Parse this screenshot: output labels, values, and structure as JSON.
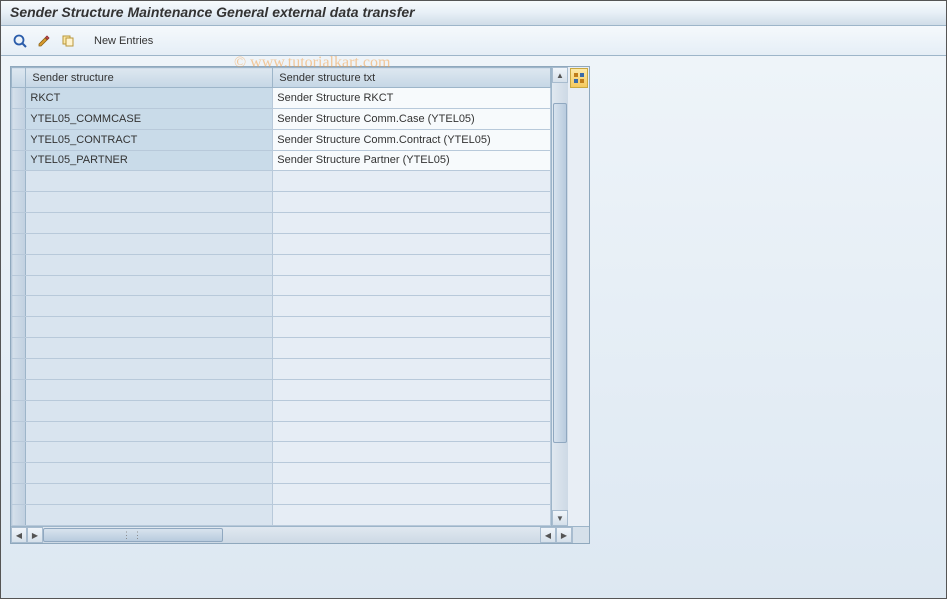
{
  "title": "Sender Structure Maintenance General external data transfer",
  "watermark": "© www.tutorialkart.com",
  "toolbar": {
    "display_icon": "display-icon",
    "change_icon": "change-icon",
    "copy_icon": "copy-icon",
    "new_entries_label": "New Entries"
  },
  "table": {
    "columns": {
      "structure": "Sender structure",
      "text": "Sender structure txt"
    },
    "rows": [
      {
        "structure": "RKCT",
        "text": "Sender Structure RKCT"
      },
      {
        "structure": "YTEL05_COMMCASE",
        "text": "Sender Structure Comm.Case (YTEL05)"
      },
      {
        "structure": "YTEL05_CONTRACT",
        "text": "Sender Structure Comm.Contract (YTEL05)"
      },
      {
        "structure": "YTEL05_PARTNER",
        "text": "Sender Structure Partner (YTEL05)"
      }
    ],
    "empty_row_count": 17
  }
}
